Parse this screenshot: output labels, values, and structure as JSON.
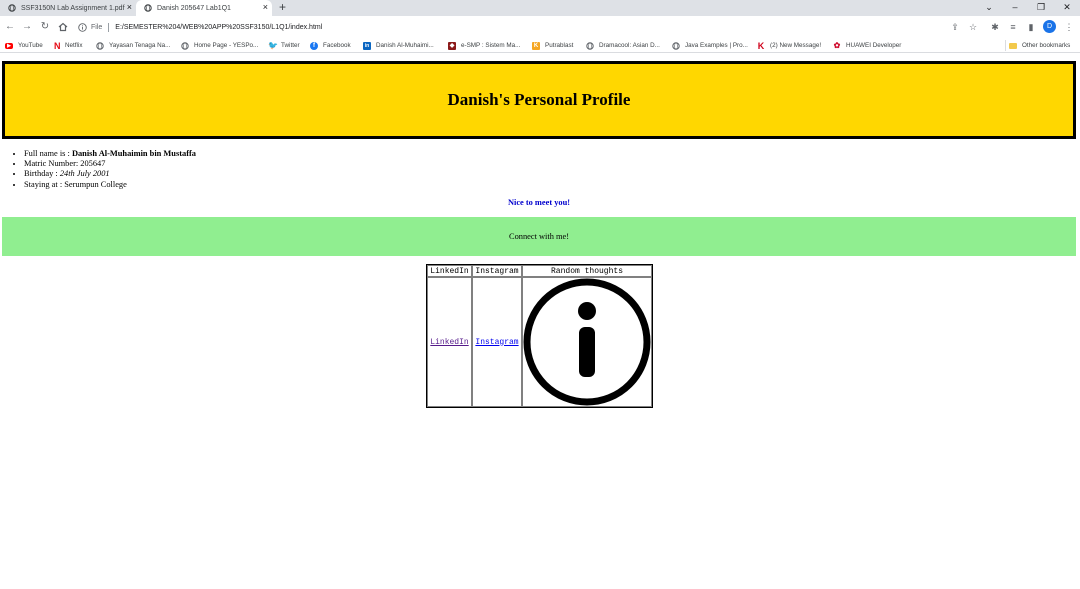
{
  "tabs": [
    {
      "title": "SSF3150N Lab Assignment 1.pdf"
    },
    {
      "title": "Danish 205647 Lab1Q1"
    }
  ],
  "address": {
    "prefix": "File",
    "url": "E:/SEMESTER%204/WEB%20APP%20SSF3150/L1Q1/index.html"
  },
  "profile_initial": "D",
  "bookmarks": [
    {
      "label": "YouTube",
      "icon": "youtube-icon",
      "color": "#ff0000"
    },
    {
      "label": "Netflix",
      "icon": "netflix-icon",
      "color": "#e50914"
    },
    {
      "label": "Yayasan Tenaga Na...",
      "icon": "globe-icon",
      "color": "#5f6368"
    },
    {
      "label": "Home Page - YESPo...",
      "icon": "globe-icon",
      "color": "#5f6368"
    },
    {
      "label": "Twitter",
      "icon": "twitter-icon",
      "color": "#1da1f2"
    },
    {
      "label": "Facebook",
      "icon": "facebook-icon",
      "color": "#1877f2"
    },
    {
      "label": "Danish Al-Muhaimi...",
      "icon": "linkedin-icon",
      "color": "#0a66c2"
    },
    {
      "label": "e-SMP : Sistem Ma...",
      "icon": "shield-icon",
      "color": "#8b1a1a"
    },
    {
      "label": "Putrablast",
      "icon": "putrablast-icon",
      "color": "#f5a623"
    },
    {
      "label": "Dramacool: Asian D...",
      "icon": "globe-icon",
      "color": "#5f6368"
    },
    {
      "label": "Java Examples | Pro...",
      "icon": "globe-icon",
      "color": "#5f6368"
    },
    {
      "label": "(2) New Message!",
      "icon": "k-icon",
      "color": "#d0021b"
    },
    {
      "label": "HUAWEI Developer",
      "icon": "huawei-icon",
      "color": "#cf0a2c"
    }
  ],
  "other_bookmarks": "Other bookmarks",
  "page": {
    "heading": "Danish's Personal Profile",
    "list": {
      "name_label": "Full name is : ",
      "name_value": "Danish Al-Muhaimin bin Mustaffa",
      "matric": "Matric Number: 205647",
      "birthday_label": "Birthday : ",
      "birthday_value": "24th July 2001",
      "staying": "Staying at : Serumpun College"
    },
    "greeting": "Nice to meet you!",
    "connect": "Connect with me!",
    "table": {
      "headers": [
        "LinkedIn",
        "Instagram",
        "Random thoughts"
      ],
      "linkedin_link": "LinkedIn",
      "instagram_link": "Instagram"
    }
  }
}
